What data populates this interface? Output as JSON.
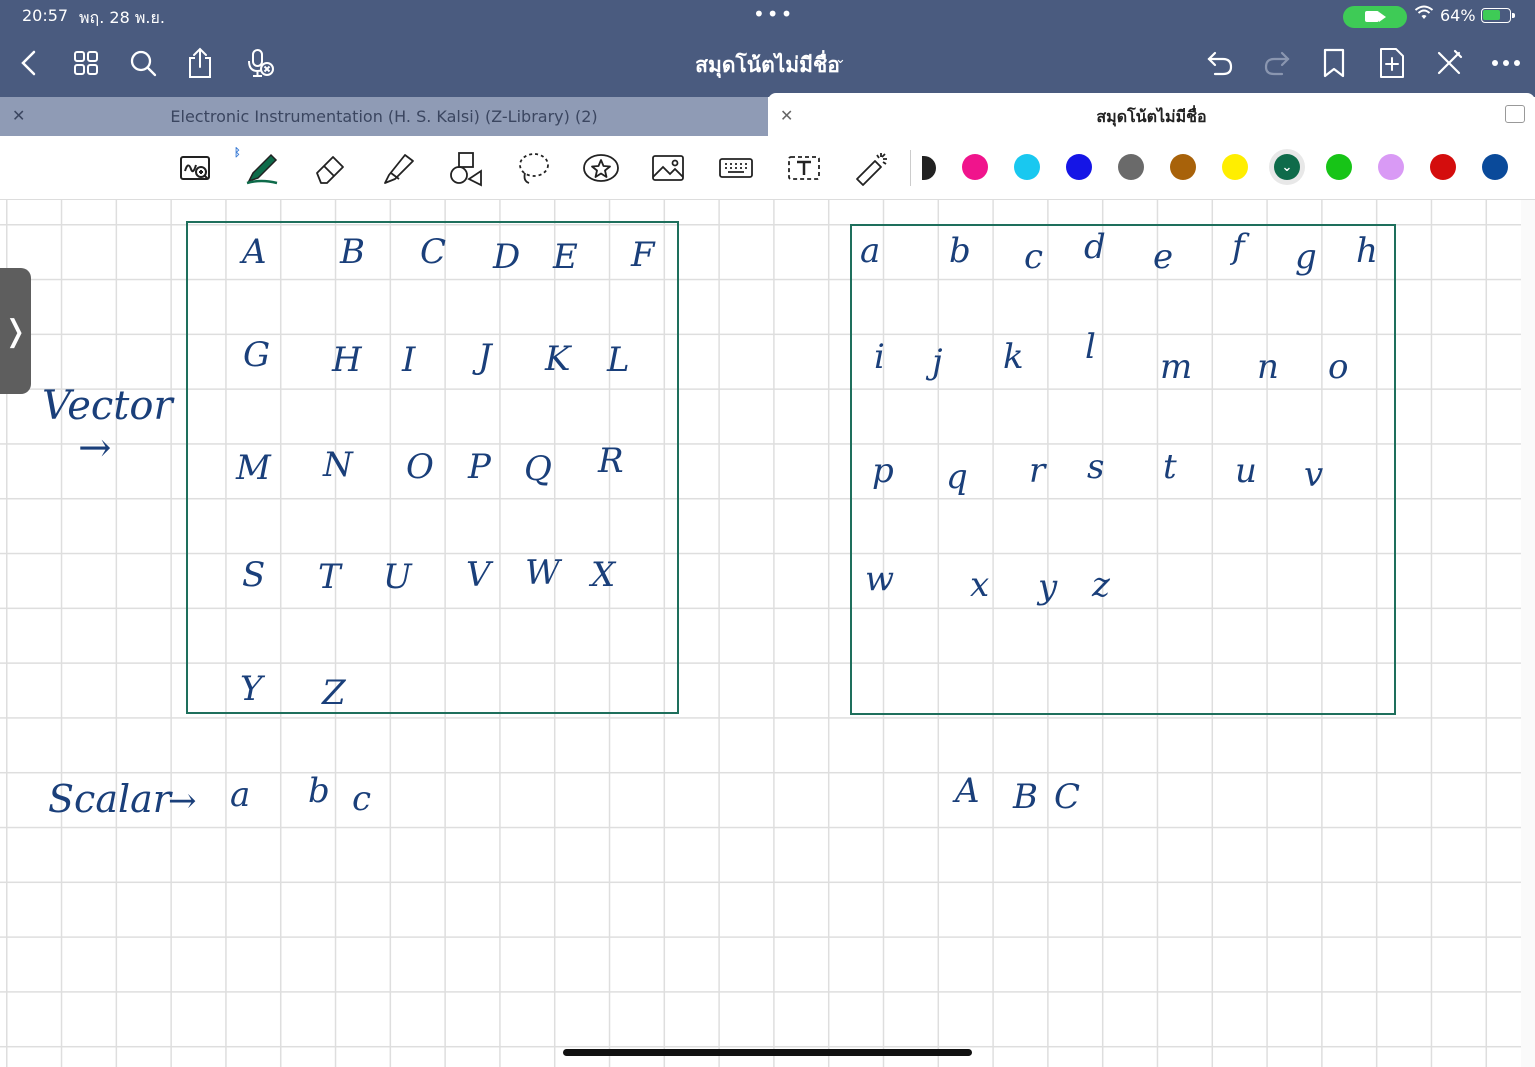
{
  "status_bar": {
    "time": "20:57",
    "date": "พฤ. 28 พ.ย.",
    "battery": "64%"
  },
  "nav": {
    "title": "สมุดโน้ตไม่มีชื่อ"
  },
  "tabs": [
    {
      "label": "Electronic Instrumentation (H. S. Kalsi) (Z-Library) (2)",
      "active": false
    },
    {
      "label": "สมุดโน้ตไม่มีชื่อ",
      "active": true
    }
  ],
  "toolbar": {
    "tools": [
      "zoom-write-icon",
      "pen-icon",
      "eraser-icon",
      "highlighter-icon",
      "shapes-icon",
      "lasso-icon",
      "sticker-icon",
      "image-icon",
      "keyboard-icon",
      "text-box-icon",
      "laser-pointer-icon"
    ],
    "colors": [
      "#f0148c",
      "#19c8f0",
      "#1515e6",
      "#6a6a6a",
      "#a8620a",
      "#ffee00",
      "#0e6b4a",
      "#17c417",
      "#d99af5",
      "#d40d0d",
      "#0a4a9a"
    ],
    "selected_color": "#0e6b4a"
  },
  "canvas": {
    "ink_color": "#1a3f7a",
    "box_color": "#1e6f5c",
    "uppercase_letters": [
      "A",
      "B",
      "C",
      "D",
      "E",
      "F",
      "G",
      "H",
      "I",
      "J",
      "K",
      "L",
      "M",
      "N",
      "O",
      "P",
      "Q",
      "R",
      "S",
      "T",
      "U",
      "V",
      "W",
      "X",
      "Y",
      "Z"
    ],
    "lowercase_letters": [
      "a",
      "b",
      "c",
      "d",
      "e",
      "f",
      "g",
      "h",
      "i",
      "j",
      "k",
      "l",
      "m",
      "n",
      "o",
      "p",
      "q",
      "r",
      "s",
      "t",
      "u",
      "v",
      "w",
      "x",
      "y",
      "z"
    ],
    "vector_label": "Vector",
    "vector_arrow": "→",
    "scalar_label": "Scalar",
    "scalar_arrow": "→",
    "scalar_letters": [
      "a",
      "b",
      "c"
    ],
    "caps_letters": [
      "A",
      "B",
      "C"
    ]
  }
}
